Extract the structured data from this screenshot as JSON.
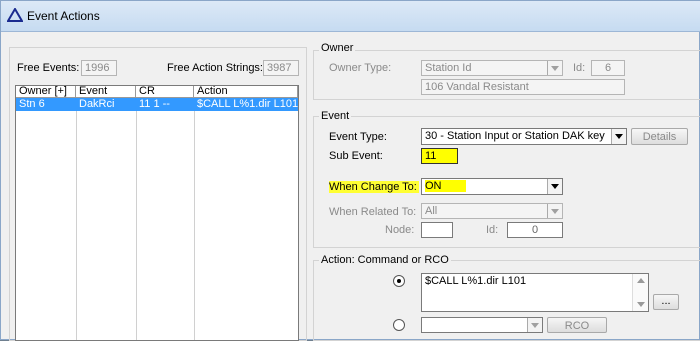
{
  "window": {
    "title": "Event Actions"
  },
  "left": {
    "free_events_label": "Free Events:",
    "free_events_value": "1996",
    "free_action_strings_label": "Free Action Strings:",
    "free_action_strings_value": "3987",
    "columns": [
      "Owner [+]",
      "Event",
      "CR",
      "Action"
    ],
    "rows": [
      {
        "owner": "Stn 6",
        "event": "DakRci",
        "cr": "11 1 --",
        "action": "$CALL L%1.dir L101"
      }
    ]
  },
  "owner": {
    "group_title": "Owner",
    "owner_type_label": "Owner Type:",
    "owner_type_value": "Station Id",
    "id_label": "Id:",
    "id_value": "6",
    "description": "106 Vandal Resistant"
  },
  "event": {
    "group_title": "Event",
    "event_type_label": "Event Type:",
    "event_type_value": "30 - Station Input or Station DAK key",
    "details_label": "Details",
    "sub_event_label": "Sub Event:",
    "sub_event_value": "11",
    "when_change_label": "When Change To:",
    "when_change_value": "ON",
    "when_related_label": "When Related To:",
    "when_related_value": "All",
    "node_label": "Node:",
    "node_value": "",
    "id_label": "Id:",
    "id_value": "0"
  },
  "action": {
    "group_title": "Action: Command or RCO",
    "command_value": "$CALL L%1.dir L101",
    "ellipsis_label": "...",
    "rco_label": "RCO",
    "rco_value": ""
  }
}
